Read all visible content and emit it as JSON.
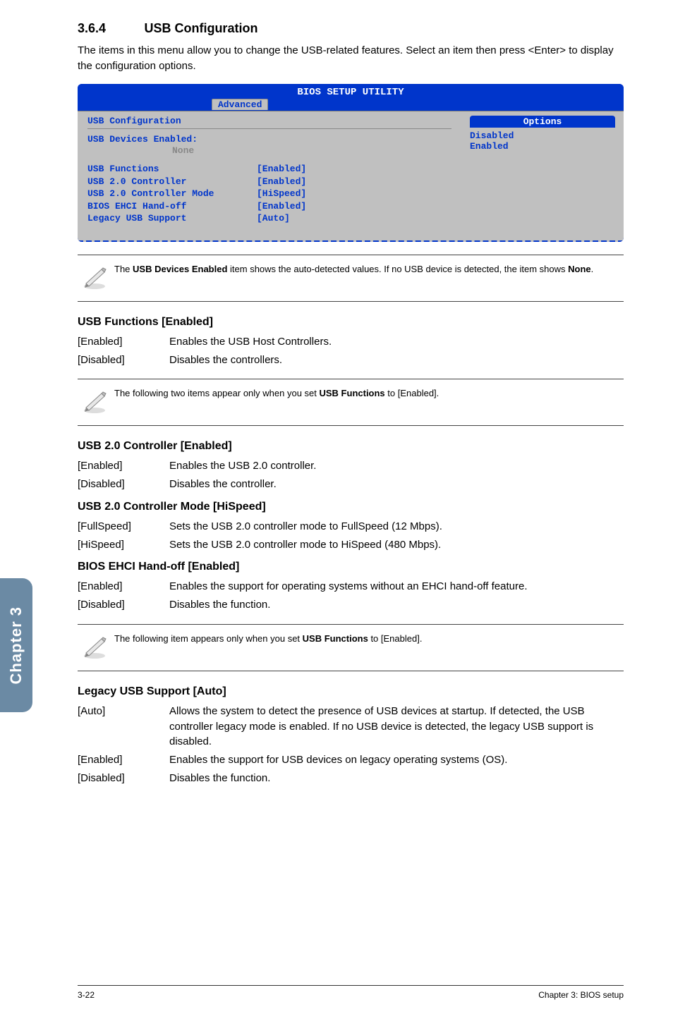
{
  "section": {
    "number": "3.6.4",
    "title": "USB Configuration"
  },
  "intro": "The items in this menu allow you to change the USB-related features. Select an item then press <Enter> to display the configuration options.",
  "bios": {
    "top_title": "BIOS SETUP UTILITY",
    "tab": "Advanced",
    "left_title": "USB Configuration",
    "devices_label": "USB Devices Enabled:",
    "devices_value": "None",
    "rows": [
      {
        "label": "USB Functions",
        "value": "[Enabled]"
      },
      {
        "label": "USB 2.0 Controller",
        "value": "[Enabled]"
      },
      {
        "label": "USB 2.0 Controller Mode",
        "value": "[HiSpeed]"
      },
      {
        "label": "BIOS EHCI Hand-off",
        "value": "[Enabled]"
      },
      {
        "label": "Legacy USB Support",
        "value": "[Auto]"
      }
    ],
    "options_header": "Options",
    "options": [
      {
        "label": "Disabled",
        "selected": false
      },
      {
        "label": "Enabled",
        "selected": false
      }
    ]
  },
  "note1_a": "The ",
  "note1_b": "USB Devices Enabled",
  "note1_c": " item shows the auto-detected values. If no USB device is detected, the item shows ",
  "note1_d": "None",
  "note1_e": ".",
  "sub1": {
    "title": "USB Functions [Enabled]",
    "rows": [
      {
        "key": "[Enabled]",
        "desc": "Enables the USB Host Controllers."
      },
      {
        "key": "[Disabled]",
        "desc": "Disables the controllers."
      }
    ]
  },
  "note2_a": "The following two items appear only when you set ",
  "note2_b": "USB Functions",
  "note2_c": " to [Enabled].",
  "sub2": {
    "title": "USB 2.0 Controller [Enabled]",
    "rows": [
      {
        "key": "[Enabled]",
        "desc": "Enables the USB 2.0 controller."
      },
      {
        "key": "[Disabled]",
        "desc": "Disables the controller."
      }
    ]
  },
  "sub3": {
    "title": "USB 2.0 Controller Mode [HiSpeed]",
    "rows": [
      {
        "key": "[FullSpeed]",
        "desc": "Sets the USB 2.0 controller mode to FullSpeed (12 Mbps)."
      },
      {
        "key": "[HiSpeed]",
        "desc": "Sets the USB 2.0 controller mode to HiSpeed (480 Mbps)."
      }
    ]
  },
  "sub4": {
    "title": "BIOS EHCI Hand-off [Enabled]",
    "rows": [
      {
        "key": "[Enabled]",
        "desc": "Enables the support for operating systems without an EHCI hand-off feature."
      },
      {
        "key": "[Disabled]",
        "desc": "Disables the function."
      }
    ]
  },
  "note3_a": "The following item appears only when you set ",
  "note3_b": "USB Functions",
  "note3_c": " to [Enabled].",
  "sub5": {
    "title": "Legacy USB Support [Auto]",
    "rows": [
      {
        "key": "[Auto]",
        "desc": "Allows the system to detect the presence of USB devices at startup. If detected, the USB controller legacy mode is enabled. If no USB device is detected, the legacy USB support is disabled."
      },
      {
        "key": "[Enabled]",
        "desc": "Enables the support for USB devices on legacy operating systems (OS)."
      },
      {
        "key": "[Disabled]",
        "desc": "Disables the function."
      }
    ]
  },
  "sidetab": "Chapter 3",
  "footer": {
    "left": "3-22",
    "right": "Chapter 3: BIOS setup"
  }
}
